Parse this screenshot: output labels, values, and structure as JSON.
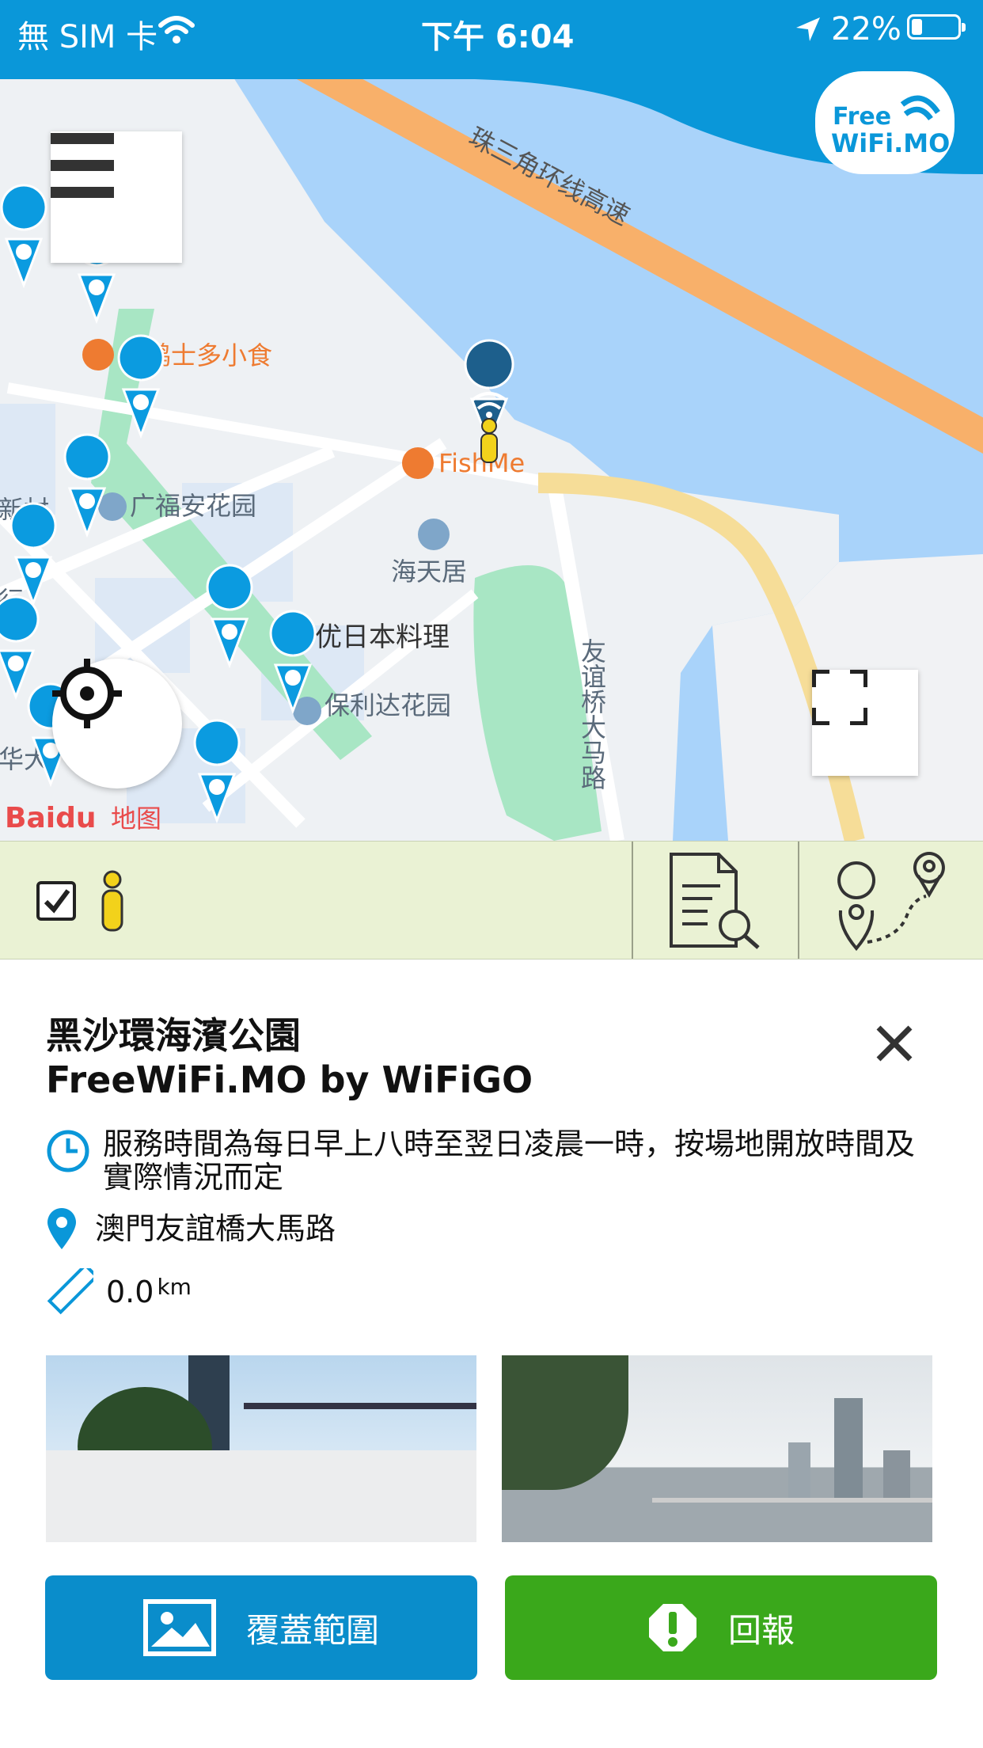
{
  "status_bar": {
    "carrier": "無 SIM 卡",
    "time": "下午 6:04",
    "battery": "22%"
  },
  "logo": {
    "line1": "Free",
    "line2": "WiFi.MO"
  },
  "map": {
    "highway_label": "珠三角环线高速",
    "poi_minghong": "铭鸿士多小食",
    "poi_fishme": "FishMe",
    "poi_guangfu": "广福安花园",
    "poi_haitian": "海天居",
    "poi_yiyou": "一优日本料理",
    "poi_baolida": "保利达花园",
    "road_youyi": "友谊桥大马路",
    "edge_xincun": "新村",
    "edge_hang": "行",
    "edge_hua": "华大",
    "baidu_logo_text": "Baidu",
    "baidu_map_text": "地图",
    "icons": [
      "menu-icon",
      "locate-icon",
      "fullscreen-icon"
    ]
  },
  "toolbar": {
    "checkbox_checked": true,
    "icons": [
      "checkbox-icon",
      "person-icon",
      "search-document-icon",
      "route-icon"
    ]
  },
  "detail": {
    "title": "黑沙環海濱公園",
    "subtitle": "FreeWiFi.MO by WiFiGO",
    "hours": "服務時間為每日早上八時至翌日凌晨一時，按場地開放時間及實際情況而定",
    "address": "澳門友誼橋大馬路",
    "distance_value": "0.0",
    "distance_unit": "km"
  },
  "actions": {
    "coverage_label": "覆蓋範圍",
    "report_label": "回報"
  },
  "colors": {
    "brand_blue": "#0a97d9",
    "map_water": "#a9d3fa",
    "coverage_button": "#0a8dcb",
    "report_button": "#3aa81b",
    "toolbar_bg": "#eaf2d4"
  }
}
